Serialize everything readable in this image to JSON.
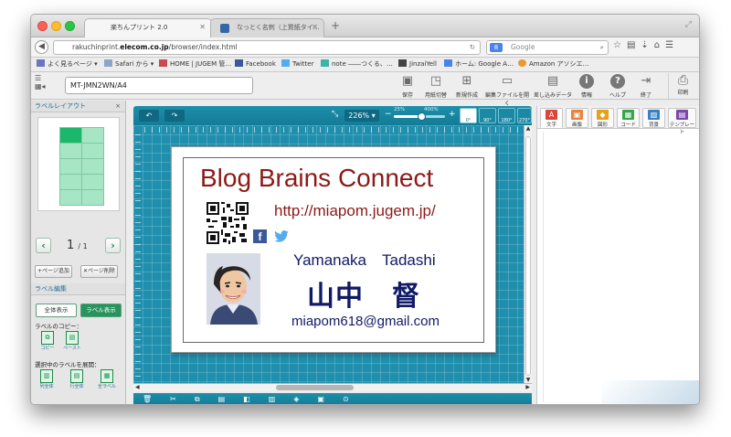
{
  "browser": {
    "tabs": [
      {
        "label": "楽ちんプリント 2.0",
        "active": true
      },
      {
        "label": "なっとく名刺（上質紙タイ…",
        "active": false
      }
    ],
    "url_prefix": "rakuchinprint.",
    "url_domain": "elecom.co.jp",
    "url_path": "/browser/index.html",
    "search_placeholder": "Google",
    "bookmarks": [
      "よく見るページ ▾",
      "Safari から ▾",
      "HOME | JUGEM 管…",
      "Facebook",
      "Twitter",
      "note ――つくる、…",
      "JinzaiYell",
      "ホーム: Google A…",
      "Amazon アソシエ…"
    ]
  },
  "app": {
    "size_field": "MT-JMN2WN/A4",
    "toolbar": [
      {
        "label": "保存",
        "icon": "save-icon"
      },
      {
        "label": "用紙切替",
        "icon": "paper-switch-icon"
      },
      {
        "label": "新規作成",
        "icon": "new-document-icon"
      },
      {
        "label": "編集ファイルを開く",
        "icon": "open-file-icon"
      },
      {
        "label": "差し込みデータ",
        "icon": "merge-data-icon"
      },
      {
        "label": "情報",
        "icon": "info-icon"
      },
      {
        "label": "ヘルプ",
        "icon": "help-icon"
      },
      {
        "label": "終了",
        "icon": "exit-icon"
      }
    ],
    "print_label": "印刷"
  },
  "left_panel": {
    "layout_title": "ラベルレイアウト",
    "close": "×",
    "page_current": "1",
    "page_total": "/ 1",
    "add_page": "+ページ追加",
    "delete_page": "✕ページ削除",
    "edit_title": "ラベル編集",
    "show_all": "全体表示",
    "show_label": "ラベル表示",
    "copy_title": "ラベルのコピー：",
    "copy": "コピー",
    "paste": "ペースト",
    "expand_title": "選択中のラベルを展開：",
    "expand_col": "列全体",
    "expand_row": "行全体",
    "expand_all": "全ラベル"
  },
  "canvas": {
    "zoom": "226%",
    "zoom_min": "25%",
    "zoom_max": "400%",
    "zoom_level_percent": 226,
    "zoom_range_percent": [
      25,
      400
    ],
    "rotations": [
      "0°",
      "90°",
      "180°",
      "270°"
    ]
  },
  "card": {
    "title": "Blog Brains Connect",
    "url": "http://miapom.jugem.jp/",
    "name_romaji": "Yamanaka　Tadashi",
    "name_kanji": "山中　督",
    "email": "miapom618@gmail.com"
  },
  "right_panel": {
    "tabs": [
      {
        "label": "文字",
        "color": "#d9463a",
        "icon": "text-icon"
      },
      {
        "label": "画像",
        "color": "#e8843b",
        "icon": "image-icon"
      },
      {
        "label": "図形",
        "color": "#e3a21a",
        "icon": "shape-icon"
      },
      {
        "label": "コード",
        "color": "#39a34e",
        "icon": "barcode-icon"
      },
      {
        "label": "背景",
        "color": "#3a7fc4",
        "icon": "background-icon"
      },
      {
        "label": "テンプレート",
        "color": "#7a4aa8",
        "icon": "template-icon"
      }
    ]
  },
  "colors": {
    "accent": "#1f8fad",
    "card_title": "#8c1a17",
    "card_text": "#111a66",
    "green": "#26945c"
  }
}
